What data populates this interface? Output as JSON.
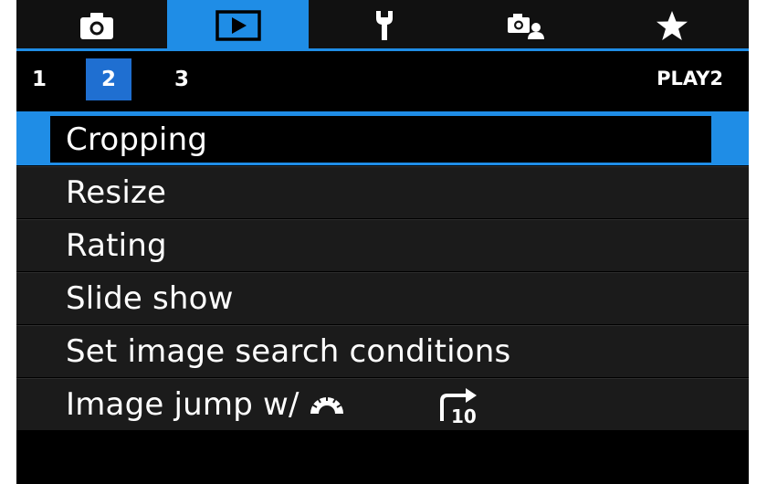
{
  "tabs": [
    {
      "icon": "camera-icon",
      "active": false
    },
    {
      "icon": "playback-icon",
      "active": true
    },
    {
      "icon": "wrench-icon",
      "active": false
    },
    {
      "icon": "custom-camera-icon",
      "active": false
    },
    {
      "icon": "star-icon",
      "active": false
    }
  ],
  "pages": [
    "1",
    "2",
    "3"
  ],
  "active_page": "2",
  "page_label": "PLAY2",
  "menu_items": [
    {
      "label": "Cropping",
      "selected": true
    },
    {
      "label": "Resize"
    },
    {
      "label": "Rating"
    },
    {
      "label": "Slide show"
    },
    {
      "label": "Set image search conditions"
    },
    {
      "label": "Image jump w/",
      "icons": [
        "main-dial-icon",
        "jump-10-icon"
      ],
      "jump_number": "10"
    }
  ],
  "colors": {
    "accent": "#1f8de6",
    "active_page_bg": "#1f6fd1",
    "row_bg": "#1b1b1b"
  }
}
